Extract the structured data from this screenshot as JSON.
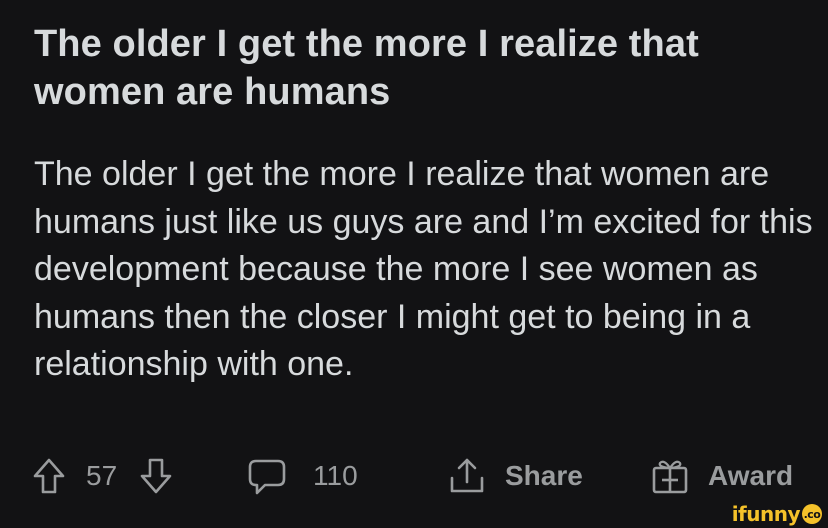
{
  "post": {
    "title": "The older I get the more I realize that women are humans",
    "body": "The older I get the more I realize that women are humans just like us guys are and I’m excited for this development because the more I see women as humans then the closer I might get to being in a relationship with one."
  },
  "actions": {
    "upvote_icon": "arrow-up-outline-icon",
    "score": "57",
    "downvote_icon": "arrow-down-outline-icon",
    "comment_icon": "speech-bubble-icon",
    "comment_count": "110",
    "share_icon": "share-upload-icon",
    "share_label": "Share",
    "award_icon": "gift-award-icon",
    "award_label": "Award"
  },
  "watermark": {
    "text": "ifunny",
    "badge": ".co"
  },
  "colors": {
    "background": "#121214",
    "text": "#d7dadc",
    "muted": "#9a9c9e",
    "watermark": "#f5c22a"
  }
}
